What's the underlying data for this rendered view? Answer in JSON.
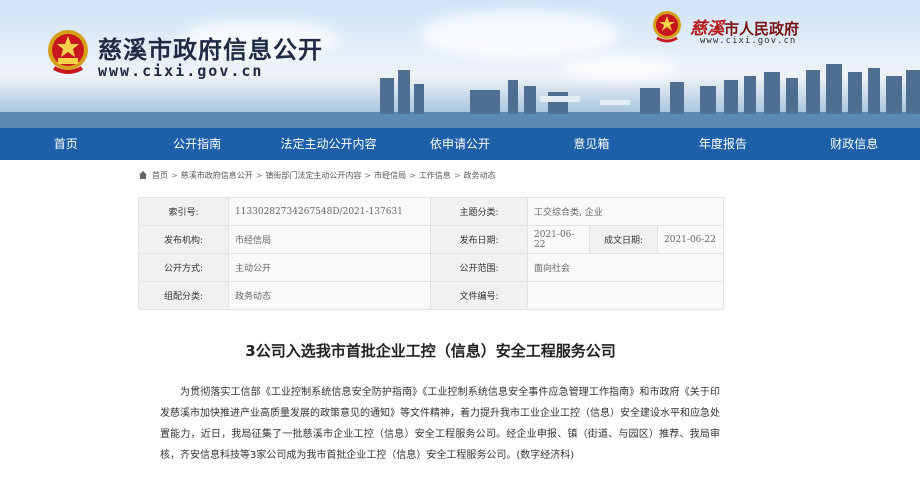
{
  "header": {
    "site_title": "慈溪市政府信息公开",
    "site_url": "www.cixi.gov.cn",
    "gov_city": "慈溪",
    "gov_name": "市人民政府",
    "gov_url": "www.cixi.gov.cn"
  },
  "nav": {
    "items": [
      "首页",
      "公开指南",
      "法定主动公开内容",
      "依申请公开",
      "意见箱",
      "年度报告",
      "财政信息"
    ]
  },
  "breadcrumb": {
    "items": [
      "首页",
      "慈溪市政府信息公开",
      "镇街部门法定主动公开内容",
      "市经信局",
      "工作信息",
      "政务动态"
    ]
  },
  "meta": {
    "index_label": "索引号:",
    "index_value": "11330282734267548D/2021-137631",
    "topic_label": "主题分类:",
    "topic_value": "工交综合类, 企业",
    "org_label": "发布机构:",
    "org_value": "市经信局",
    "date_label": "发布日期:",
    "date_value": "2021-06-22",
    "created_label": "成文日期:",
    "created_value": "2021-06-22",
    "mode_label": "公开方式:",
    "mode_value": "主动公开",
    "scope_label": "公开范围:",
    "scope_value": "面向社会",
    "group_label": "组配分类:",
    "group_value": "政务动态",
    "docnum_label": "文件编号:",
    "docnum_value": ""
  },
  "article": {
    "title": "3公司入选我市首批企业工控（信息）安全工程服务公司",
    "body": "为贯彻落实工信部《工业控制系统信息安全防护指南》《工业控制系统信息安全事件应急管理工作指南》和市政府《关于印发慈溪市加快推进产业高质量发展的政策意见的通知》等文件精神，着力提升我市工业企业工控（信息）安全建设水平和应急处置能力，近日，我局征集了一批慈溪市企业工控（信息）安全工程服务公司。经企业申报、镇（街道、与园区）推荐、我局审核，齐安信息科技等3家公司成为我市首批企业工控（信息）安全工程服务公司。(数字经济科)"
  }
}
